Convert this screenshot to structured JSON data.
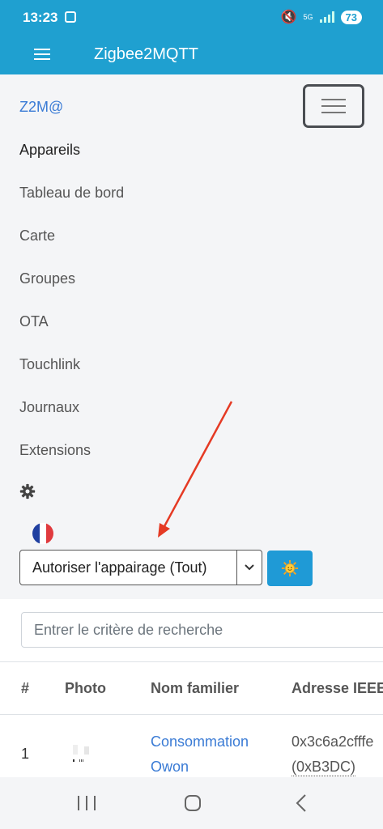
{
  "status_bar": {
    "time": "13:23",
    "network": "5G",
    "battery": "73",
    "icons": [
      "screen-record-icon",
      "mute-icon",
      "signal-icon"
    ]
  },
  "app_bar": {
    "title": "Zigbee2MQTT",
    "menu_icon": "hamburger-icon"
  },
  "nav": {
    "brand": "Z2M@",
    "items": [
      {
        "label": "Appareils",
        "active": true
      },
      {
        "label": "Tableau de bord",
        "active": false
      },
      {
        "label": "Carte",
        "active": false
      },
      {
        "label": "Groupes",
        "active": false
      },
      {
        "label": "OTA",
        "active": false
      },
      {
        "label": "Touchlink",
        "active": false
      },
      {
        "label": "Journaux",
        "active": false
      },
      {
        "label": "Extensions",
        "active": false
      }
    ],
    "settings_icon": "gear-icon",
    "language_icon": "french-flag-icon",
    "permit_join_label": "Autoriser l'appairage (Tout)",
    "theme_icon": "sun-icon"
  },
  "devices": {
    "search_placeholder": "Entrer le critère de recherche",
    "columns": [
      "#",
      "Photo",
      "Nom familier",
      "Adresse IEEE"
    ],
    "rows": [
      {
        "index": "1",
        "name_line1": "Consommation",
        "name_line2": "Owon",
        "ieee": "0x3c6a2cfffe",
        "nwk": "(0xB3DC)"
      }
    ]
  },
  "colors": {
    "accent": "#1fa0d0",
    "link": "#3a7bd5",
    "annotation_arrow": "#e53a24"
  }
}
